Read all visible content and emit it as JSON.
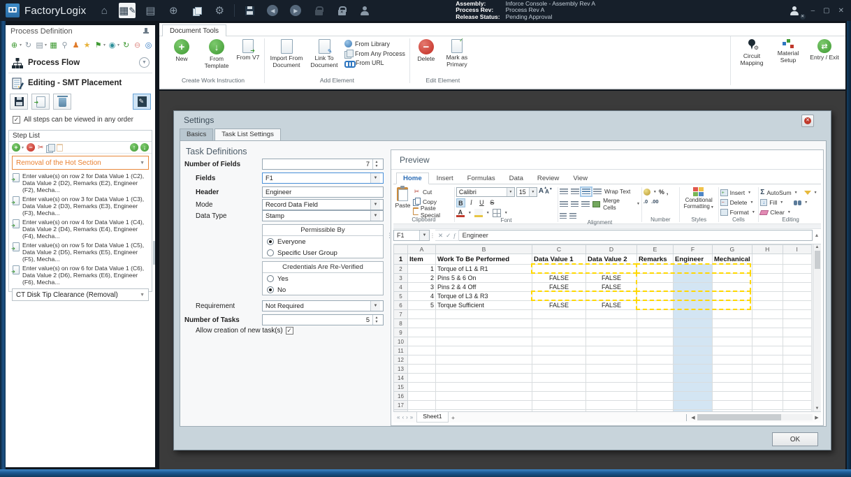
{
  "window": {
    "minimize": "–",
    "restore": "▢",
    "close": "✕"
  },
  "titlebar": {
    "app_name": "FactoryLogix",
    "assembly_label": "Assembly:",
    "assembly_value": "Inforce Console - Assembly Rev A",
    "process_rev_label": "Process Rev:",
    "process_rev_value": "Process Rev A",
    "release_label": "Release Status:",
    "release_value": "Pending Approval"
  },
  "sidebar": {
    "title": "Process Definition",
    "process_flow": "Process Flow",
    "editing_title": "Editing - SMT Placement",
    "order_checkbox": "All steps can be viewed in any order",
    "step_list_title": "Step List",
    "selected_step": "Removal of the Hot Section",
    "steps": [
      "Enter value(s) on row 2 for Data Value 1 (C2), Data Value 2 (D2), Remarks (E2), Engineer (F2), Mecha...",
      "Enter value(s) on row 3 for Data Value 1 (C3), Data Value 2 (D3), Remarks (E3), Engineer (F3), Mecha...",
      "Enter value(s) on row 4 for Data Value 1 (C4), Data Value 2 (D4), Remarks (E4), Engineer (F4), Mecha...",
      "Enter value(s) on row 5 for Data Value 1 (C5), Data Value 2 (D5), Remarks (E5), Engineer (F5), Mecha...",
      "Enter value(s) on row 6 for Data Value 1 (C6), Data Value 2 (D6), Remarks (E6), Engineer (F6), Mecha..."
    ],
    "collapsed_step": "CT Disk Tip Clearance (Removal)"
  },
  "ribbon": {
    "tab": "Document Tools",
    "create_group": {
      "label": "Create Work Instruction",
      "new": "New",
      "from_template": "From Template",
      "from_v7": "From V7"
    },
    "add_group": {
      "label": "Add Element",
      "import": "Import From Document",
      "link": "Link To Document",
      "from_library": "From Library",
      "from_any_process": "From Any Process",
      "from_url": "From URL"
    },
    "edit_group": {
      "label": "Edit Element",
      "delete": "Delete",
      "mark_primary": "Mark as Primary"
    },
    "right_group": {
      "circuit": "Circuit Mapping",
      "material": "Material Setup",
      "entry_exit": "Entry / Exit"
    }
  },
  "dialog": {
    "title": "Settings",
    "tab_basics": "Basics",
    "tab_task": "Task List Settings",
    "form": {
      "heading": "Task Definitions",
      "number_of_fields_label": "Number of Fields",
      "number_of_fields_value": "7",
      "fields_label": "Fields",
      "fields_value": "F1",
      "header_label": "Header",
      "header_value": "Engineer",
      "mode_label": "Mode",
      "mode_value": "Record Data Field",
      "data_type_label": "Data Type",
      "data_type_value": "Stamp",
      "permissible_title": "Permissible By",
      "permissible_opt1": "Everyone",
      "permissible_opt2": "Specific User Group",
      "credentials_title": "Credentials Are Re-Verified",
      "credentials_opt1": "Yes",
      "credentials_opt2": "No",
      "requirement_label": "Requirement",
      "requirement_value": "Not Required",
      "number_of_tasks_label": "Number of Tasks",
      "number_of_tasks_value": "5",
      "allow_label": "Allow creation of new task(s)"
    },
    "preview": {
      "title": "Preview",
      "excel": {
        "tabs": [
          "Home",
          "Insert",
          "Formulas",
          "Data",
          "Review",
          "View"
        ],
        "active_tab": "Home",
        "clipboard_label": "Clipboard",
        "paste": "Paste",
        "cut": "Cut",
        "copy": "Copy",
        "paste_special": "Paste Special",
        "font_label": "Font",
        "font_name": "Calibri",
        "font_size": "15",
        "alignment_label": "Alignment",
        "wrap_text": "Wrap Text",
        "merge_cells": "Merge Cells",
        "number_label": "Number",
        "styles_label": "Styles",
        "conditional_line1": "Conditional",
        "conditional_line2": "Formatting",
        "cells_label": "Cells",
        "insert": "Insert",
        "delete": "Delete",
        "format": "Format",
        "editing_label": "Editing",
        "autosum": "AutoSum",
        "fill": "Fill",
        "clear": "Clear",
        "name_box": "F1",
        "formula": "Engineer"
      },
      "grid": {
        "columns": [
          "A",
          "B",
          "C",
          "D",
          "E",
          "F",
          "G",
          "H",
          "I"
        ],
        "selected_column": "F",
        "header_row": [
          "Item",
          "Work To Be Performed",
          "Data Value 1",
          "Data Value 2",
          "Remarks",
          "Engineer",
          "Mechanical"
        ],
        "rows": [
          {
            "item": "1",
            "task": "Torque of L1 & R1",
            "dv1": "",
            "dv2": ""
          },
          {
            "item": "2",
            "task": "Pins 5 & 6 On",
            "dv1": "FALSE",
            "dv2": "FALSE"
          },
          {
            "item": "3",
            "task": "Pins 2 & 4 Off",
            "dv1": "FALSE",
            "dv2": "FALSE"
          },
          {
            "item": "4",
            "task": "Torque of L3 & R3",
            "dv1": "",
            "dv2": ""
          },
          {
            "item": "5",
            "task": "Torque Sufficient",
            "dv1": "FALSE",
            "dv2": "FALSE"
          }
        ],
        "dashed_ranges": [
          "C2:D2",
          "E2:G2",
          "E3:G4",
          "C5:D5",
          "E5:G5",
          "E6:G6"
        ],
        "row_count": 18,
        "sheet_tab": "Sheet1",
        "add_sheet": "+"
      }
    },
    "ok_label": "OK"
  },
  "colors": {
    "accent_orange": "#e87f2f",
    "selection_blue": "#d3e5f3",
    "dashed_yellow": "#ffd800",
    "home_tab_blue": "#2b6cb5",
    "titlebar_bg": "#161f2a",
    "workspace_bg": "#3b3b3b",
    "dialog_bg": "#c8d4db"
  }
}
